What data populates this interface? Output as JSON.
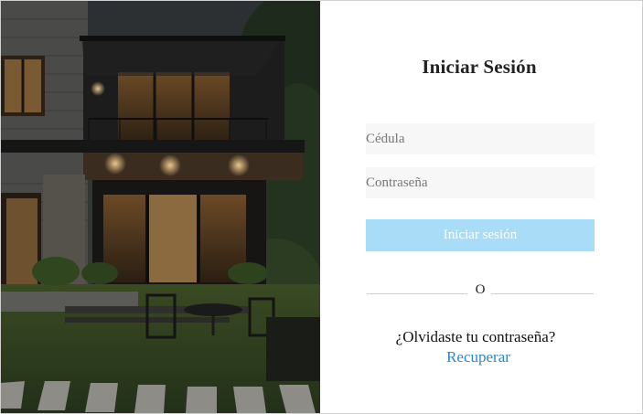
{
  "login": {
    "title": "Iniciar Sesión",
    "cedula_placeholder": "Cédula",
    "password_placeholder": "Contraseña",
    "submit_label": "Iniciar sesión",
    "divider_text": "O",
    "forgot_text": "¿Olvidaste tu contraseña?",
    "recover_link": "Recuperar"
  },
  "colors": {
    "button_bg": "#a9dcf6",
    "link": "#2e86c9",
    "input_bg": "#f7f7f7"
  },
  "image": {
    "subject": "modern-house-at-dusk"
  }
}
